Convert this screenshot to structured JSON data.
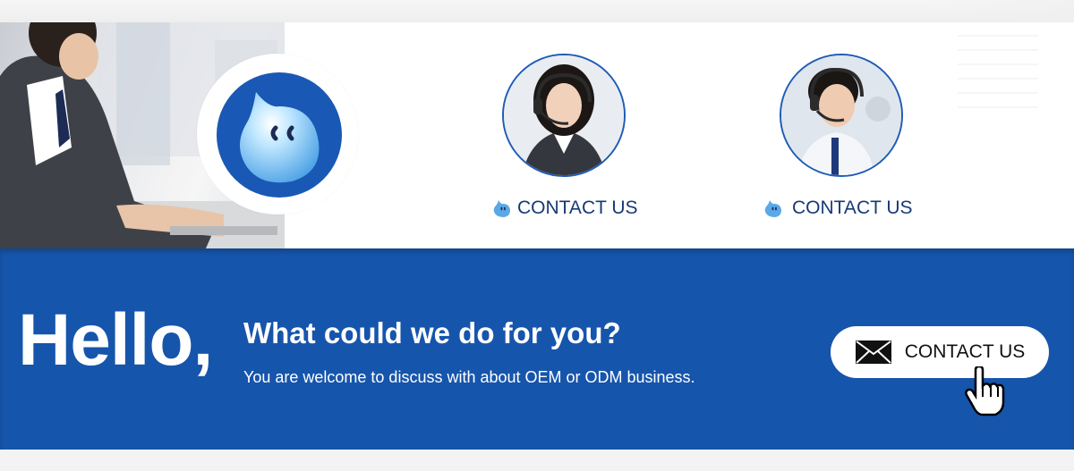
{
  "contacts": [
    {
      "label": "CONTACT US"
    },
    {
      "label": "CONTACT US"
    }
  ],
  "banner": {
    "hello": "Hello,",
    "headline": "What could we do for you?",
    "subline": "You are welcome to discuss with about OEM or ODM business.",
    "cta_label": "CONTACT US"
  },
  "colors": {
    "brand_blue": "#1655ac",
    "link_text": "#173a75",
    "white": "#ffffff"
  },
  "icons": {
    "badge": "chat-bubble-mascot-icon",
    "contact": "chat-bubble-mascot-icon",
    "cta": "envelope-icon",
    "pointer": "hand-cursor-icon"
  }
}
